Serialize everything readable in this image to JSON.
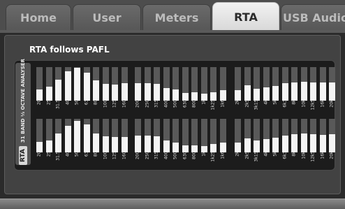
{
  "tabs": [
    {
      "label": "Home"
    },
    {
      "label": "User"
    },
    {
      "label": "Meters"
    },
    {
      "label": "RTA"
    },
    {
      "label": "USB Audio"
    }
  ],
  "panel": {
    "title": "RTA follows PAFL",
    "side_label": "RTA",
    "side_sublabel": "31 BAND ⅓ OCTAVE ANALYSER"
  },
  "bands": [
    "20",
    "25",
    "31.5",
    "40",
    "50",
    "63",
    "80",
    "100",
    "125",
    "160",
    "200",
    "250",
    "315",
    "400",
    "500",
    "630",
    "800",
    "1k",
    "1k25",
    "1k6",
    "2k",
    "2k5",
    "3k15",
    "4k",
    "5k",
    "6k3",
    "8k",
    "10k",
    "12k5",
    "16k",
    "20k"
  ],
  "rta_levels": {
    "top": [
      0.33,
      0.42,
      0.62,
      0.88,
      0.98,
      0.84,
      0.6,
      0.5,
      0.48,
      0.53,
      0.53,
      0.52,
      0.5,
      0.38,
      0.33,
      0.23,
      0.25,
      0.21,
      0.26,
      0.31,
      0.31,
      0.45,
      0.36,
      0.39,
      0.44,
      0.52,
      0.55,
      0.56,
      0.55,
      0.54,
      0.55
    ],
    "bottom": [
      0.31,
      0.36,
      0.56,
      0.8,
      0.94,
      0.84,
      0.56,
      0.47,
      0.46,
      0.45,
      0.49,
      0.49,
      0.48,
      0.36,
      0.29,
      0.21,
      0.21,
      0.18,
      0.24,
      0.29,
      0.29,
      0.41,
      0.35,
      0.39,
      0.44,
      0.51,
      0.54,
      0.56,
      0.55,
      0.53,
      0.55
    ]
  },
  "colors": {
    "active_tab": "#e6e6e6",
    "bar_fill": "#f4f4f4",
    "bar_track": "#595959",
    "background": "#424242"
  }
}
